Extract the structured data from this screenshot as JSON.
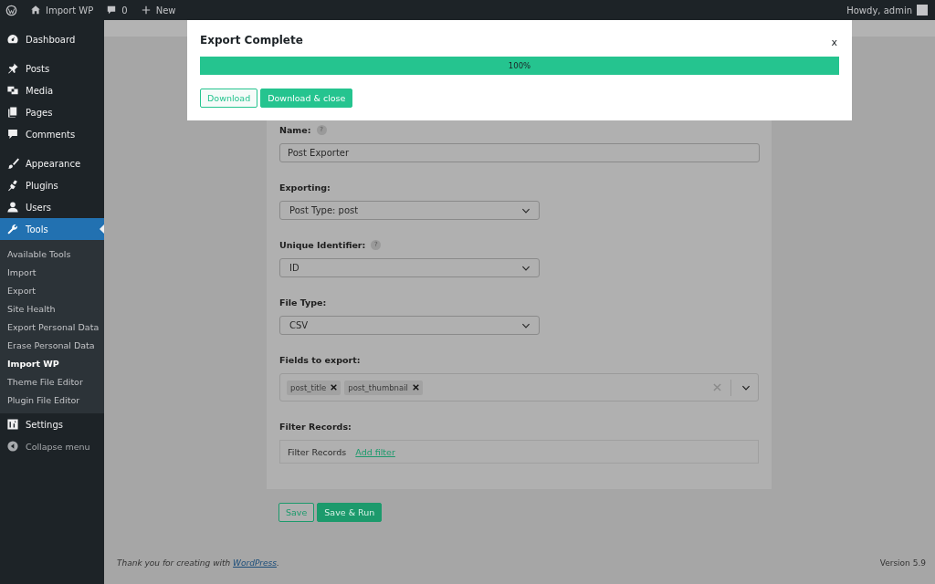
{
  "admin_bar": {
    "site": "Import WP",
    "comments": "0",
    "new": "New",
    "greeting": "Howdy, admin"
  },
  "sidebar": {
    "items": [
      {
        "label": "Dashboard",
        "selected": false
      },
      {
        "label": "Posts",
        "selected": false
      },
      {
        "label": "Media",
        "selected": false
      },
      {
        "label": "Pages",
        "selected": false
      },
      {
        "label": "Comments",
        "selected": false
      },
      {
        "label": "Appearance",
        "selected": false
      },
      {
        "label": "Plugins",
        "selected": false
      },
      {
        "label": "Users",
        "selected": false
      },
      {
        "label": "Tools",
        "selected": true,
        "submenu": [
          {
            "label": "Available Tools",
            "selected": false
          },
          {
            "label": "Import",
            "selected": false
          },
          {
            "label": "Export",
            "selected": false
          },
          {
            "label": "Site Health",
            "selected": false
          },
          {
            "label": "Export Personal Data",
            "selected": false
          },
          {
            "label": "Erase Personal Data",
            "selected": false
          },
          {
            "label": "Import WP",
            "selected": true
          },
          {
            "label": "Theme File Editor",
            "selected": false
          },
          {
            "label": "Plugin File Editor",
            "selected": false
          }
        ]
      },
      {
        "label": "Settings",
        "selected": false
      }
    ],
    "collapse": "Collapse menu"
  },
  "form": {
    "fields": [
      {
        "kind": "text",
        "label": "Name:",
        "help": "?",
        "value": "Post Exporter"
      },
      {
        "kind": "select",
        "label": "Exporting:",
        "value": "Post Type: post"
      },
      {
        "kind": "select",
        "label": "Unique Identifier:",
        "help": "?",
        "value": "ID"
      },
      {
        "kind": "select",
        "label": "File Type:",
        "value": "CSV"
      },
      {
        "kind": "tags",
        "label": "Fields to export:",
        "tags": [
          "post_title",
          "post_thumbnail"
        ]
      },
      {
        "kind": "filter",
        "label": "Filter Records:",
        "text": "Filter Records",
        "link": "Add filter"
      }
    ]
  },
  "actions": [
    {
      "label": "Save",
      "kind": "outline"
    },
    {
      "label": "Save & Run",
      "kind": "primary"
    }
  ],
  "footer": {
    "text": "Thank you for creating with ",
    "link": "WordPress",
    "after": ".",
    "version": "Version 5.9"
  },
  "modal": {
    "title": "Export Complete",
    "close": "x",
    "progress": {
      "level": 1,
      "label": "100%"
    },
    "buttons": [
      {
        "label": "Download",
        "kind": "outline"
      },
      {
        "label": "Download & close",
        "kind": "primary"
      }
    ]
  }
}
